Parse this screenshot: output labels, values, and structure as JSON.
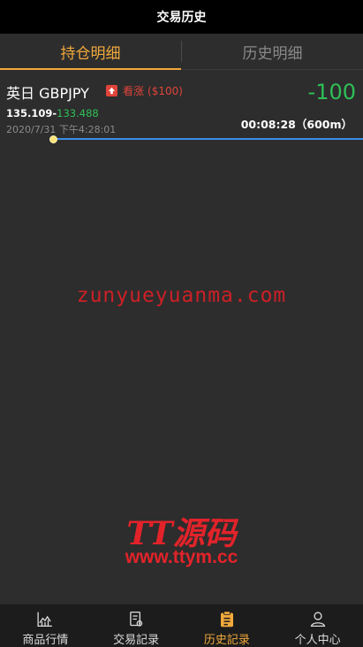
{
  "header": {
    "title": "交易历史"
  },
  "tabs": [
    {
      "label": "持仓明细",
      "active": true
    },
    {
      "label": "历史明细",
      "active": false
    }
  ],
  "position": {
    "pair": "英日 GBPJPY",
    "direction_icon": "up-arrow-icon",
    "direction_label": "看涨",
    "amount": "($100)",
    "pnl": "-100",
    "open_price": "135.109",
    "separator": "-",
    "current_price": "133.488",
    "datetime": "2020/7/31 下午4:28:01",
    "countdown": "00:08:28（600m）",
    "progress_fraction": 0.0
  },
  "watermarks": {
    "site_text": "zunyueyuanma.com",
    "logo_text": "TT源码",
    "logo_url_text": "www.ttym.cc"
  },
  "colors": {
    "accent": "#f2a93b",
    "profit_green": "#2fbf57",
    "rise_red": "#e0443a",
    "progress_blue": "#3c8ee8"
  },
  "nav": [
    {
      "label": "商品行情",
      "icon": "chart-icon",
      "active": false
    },
    {
      "label": "交易記录",
      "icon": "document-icon",
      "active": false
    },
    {
      "label": "历史記录",
      "icon": "clipboard-icon",
      "active": true
    },
    {
      "label": "个人中心",
      "icon": "person-icon",
      "active": false
    }
  ]
}
